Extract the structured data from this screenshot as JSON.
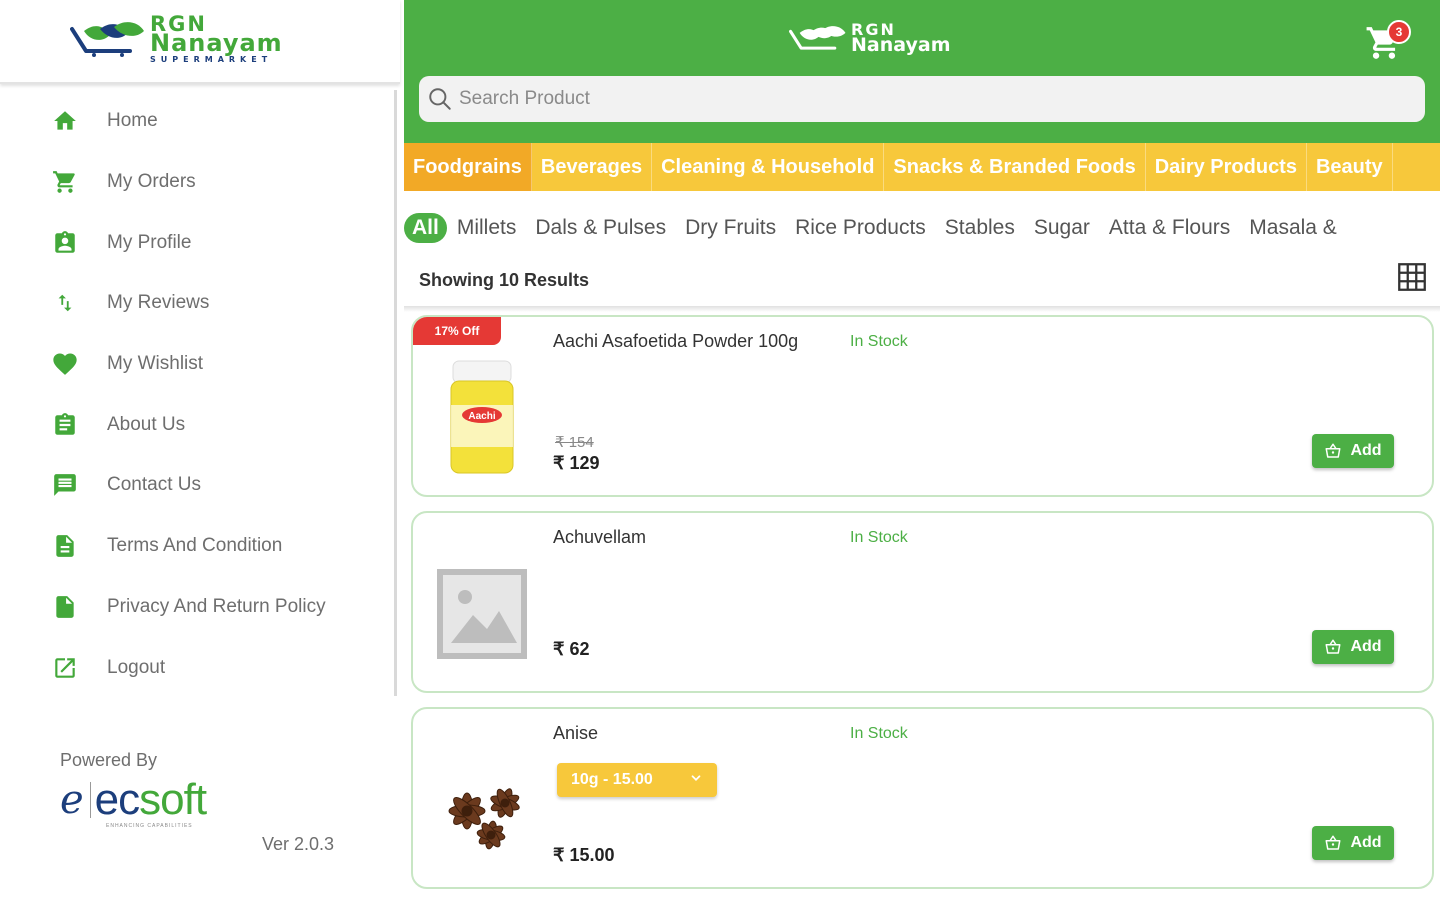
{
  "brand": {
    "line1": "RGN",
    "line2": "Nanayam",
    "line3": "SUPERMARKET"
  },
  "sidebar": {
    "items": [
      {
        "label": "Home",
        "icon": "home-icon"
      },
      {
        "label": "My Orders",
        "icon": "cart-icon"
      },
      {
        "label": "My Profile",
        "icon": "profile-badge-icon"
      },
      {
        "label": "My Reviews",
        "icon": "swap-vertical-icon"
      },
      {
        "label": "My Wishlist",
        "icon": "heart-icon"
      },
      {
        "label": "About Us",
        "icon": "clipboard-icon"
      },
      {
        "label": "Contact Us",
        "icon": "chat-icon"
      },
      {
        "label": "Terms And Condition",
        "icon": "document-icon"
      },
      {
        "label": "Privacy And Return Policy",
        "icon": "file-icon"
      },
      {
        "label": "Logout",
        "icon": "logout-icon"
      }
    ],
    "powered_by": "Powered By",
    "vendor_name_part1": "ec",
    "vendor_name_part2": "soft",
    "vendor_tagline": "ENHANCING CAPABILITIES",
    "version": "Ver 2.0.3"
  },
  "header": {
    "logo_line1": "RGN",
    "logo_line2": "Nanayam",
    "cart_count": "3",
    "search_placeholder": "Search Product"
  },
  "categories": [
    "Foodgrains",
    "Beverages",
    "Cleaning & Household",
    "Snacks & Branded Foods",
    "Dairy Products",
    "Beauty"
  ],
  "active_category": "Foodgrains",
  "subcategories": [
    "All",
    "Millets",
    "Dals & Pulses",
    "Dry Fruits",
    "Rice Products",
    "Stables",
    "Sugar",
    "Atta & Flours",
    "Masala &"
  ],
  "active_subcategory": "All",
  "results_text": "Showing 10 Results",
  "products": [
    {
      "name": "Aachi Asafoetida Powder 100g",
      "stock": "In Stock",
      "discount": "17% Off",
      "mrp": "₹ 154",
      "price": "₹ 129",
      "add_label": "Add",
      "image": "asafoetida-jar-image",
      "brand_on_pack": "Aachi"
    },
    {
      "name": "Achuvellam",
      "stock": "In Stock",
      "price": "₹ 62",
      "add_label": "Add",
      "image": "placeholder-image"
    },
    {
      "name": "Anise",
      "stock": "In Stock",
      "variant": "10g - 15.00",
      "price": "₹ 15.00",
      "add_label": "Add",
      "image": "star-anise-image"
    }
  ],
  "colors": {
    "primary_green": "#4caf45",
    "category_yellow": "#f7c83b",
    "active_category": "#f2a926",
    "discount_red": "#e53935",
    "brand_blue": "#1c3e7c"
  }
}
